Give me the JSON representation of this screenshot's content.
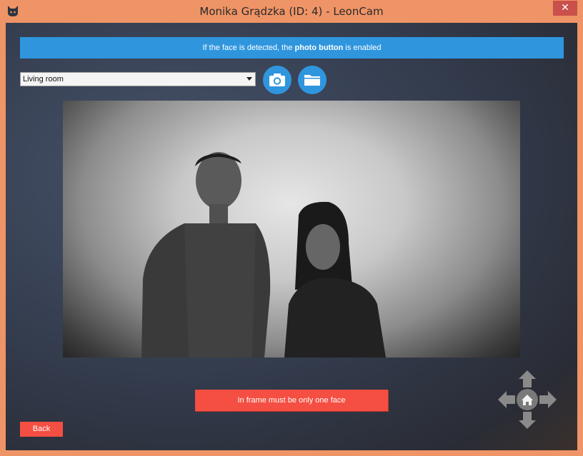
{
  "window": {
    "title": "Monika Grądzka (ID: 4) - LeonCam",
    "close_label": "✕"
  },
  "info_bar": {
    "text_before": "If the face is detected, the ",
    "text_bold": "photo button",
    "text_after": " is enabled",
    "color": "#2f96de"
  },
  "camera_select": {
    "selected": "Living room"
  },
  "buttons": {
    "photo_icon": "camera-icon",
    "folder_icon": "folder-icon",
    "warning_label": "In frame must be only one face",
    "back_label": "Back",
    "accent": "#f44f42"
  },
  "nav_pad": {
    "icons": [
      "arrow-up-icon",
      "arrow-left-icon",
      "home-icon",
      "arrow-right-icon",
      "arrow-down-icon"
    ]
  }
}
